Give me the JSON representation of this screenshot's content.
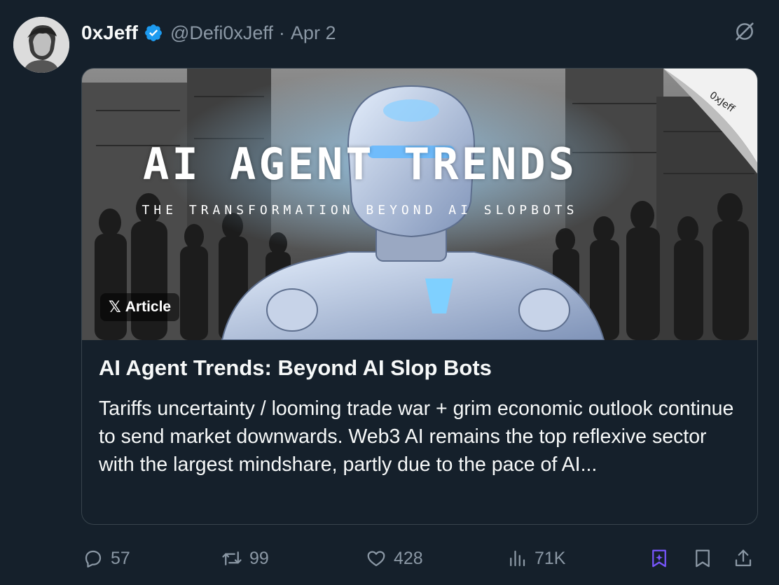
{
  "author": {
    "display_name": "0xJeff",
    "handle": "@Defi0xJeff",
    "separator": "·",
    "date": "Apr 2",
    "verified": true
  },
  "article": {
    "image_title": "AI AGENT TRENDS",
    "image_subtitle": "THE TRANSFORMATION BEYOND AI SLOPBOTS",
    "image_watermark": "0xJeff",
    "badge_logo": "𝕏",
    "badge_label": "Article",
    "title": "AI Agent Trends: Beyond AI Slop Bots",
    "excerpt": "Tariffs uncertainty / looming trade war + grim economic outlook continue to send market downwards. Web3 AI remains the top reflexive sector with the largest mindshare, partly due to the pace of AI..."
  },
  "actions": {
    "replies": "57",
    "reposts": "99",
    "likes": "428",
    "views": "71K"
  },
  "colors": {
    "background": "#15202b",
    "border": "#38444d",
    "muted_text": "#8b98a5",
    "verified_blue": "#1d9bf0",
    "grok_purple": "#7856ff"
  },
  "icons": [
    "grok-icon",
    "verified-badge-icon",
    "reply-icon",
    "repost-icon",
    "like-icon",
    "views-icon",
    "grok-ai-icon",
    "bookmark-icon",
    "share-icon"
  ]
}
